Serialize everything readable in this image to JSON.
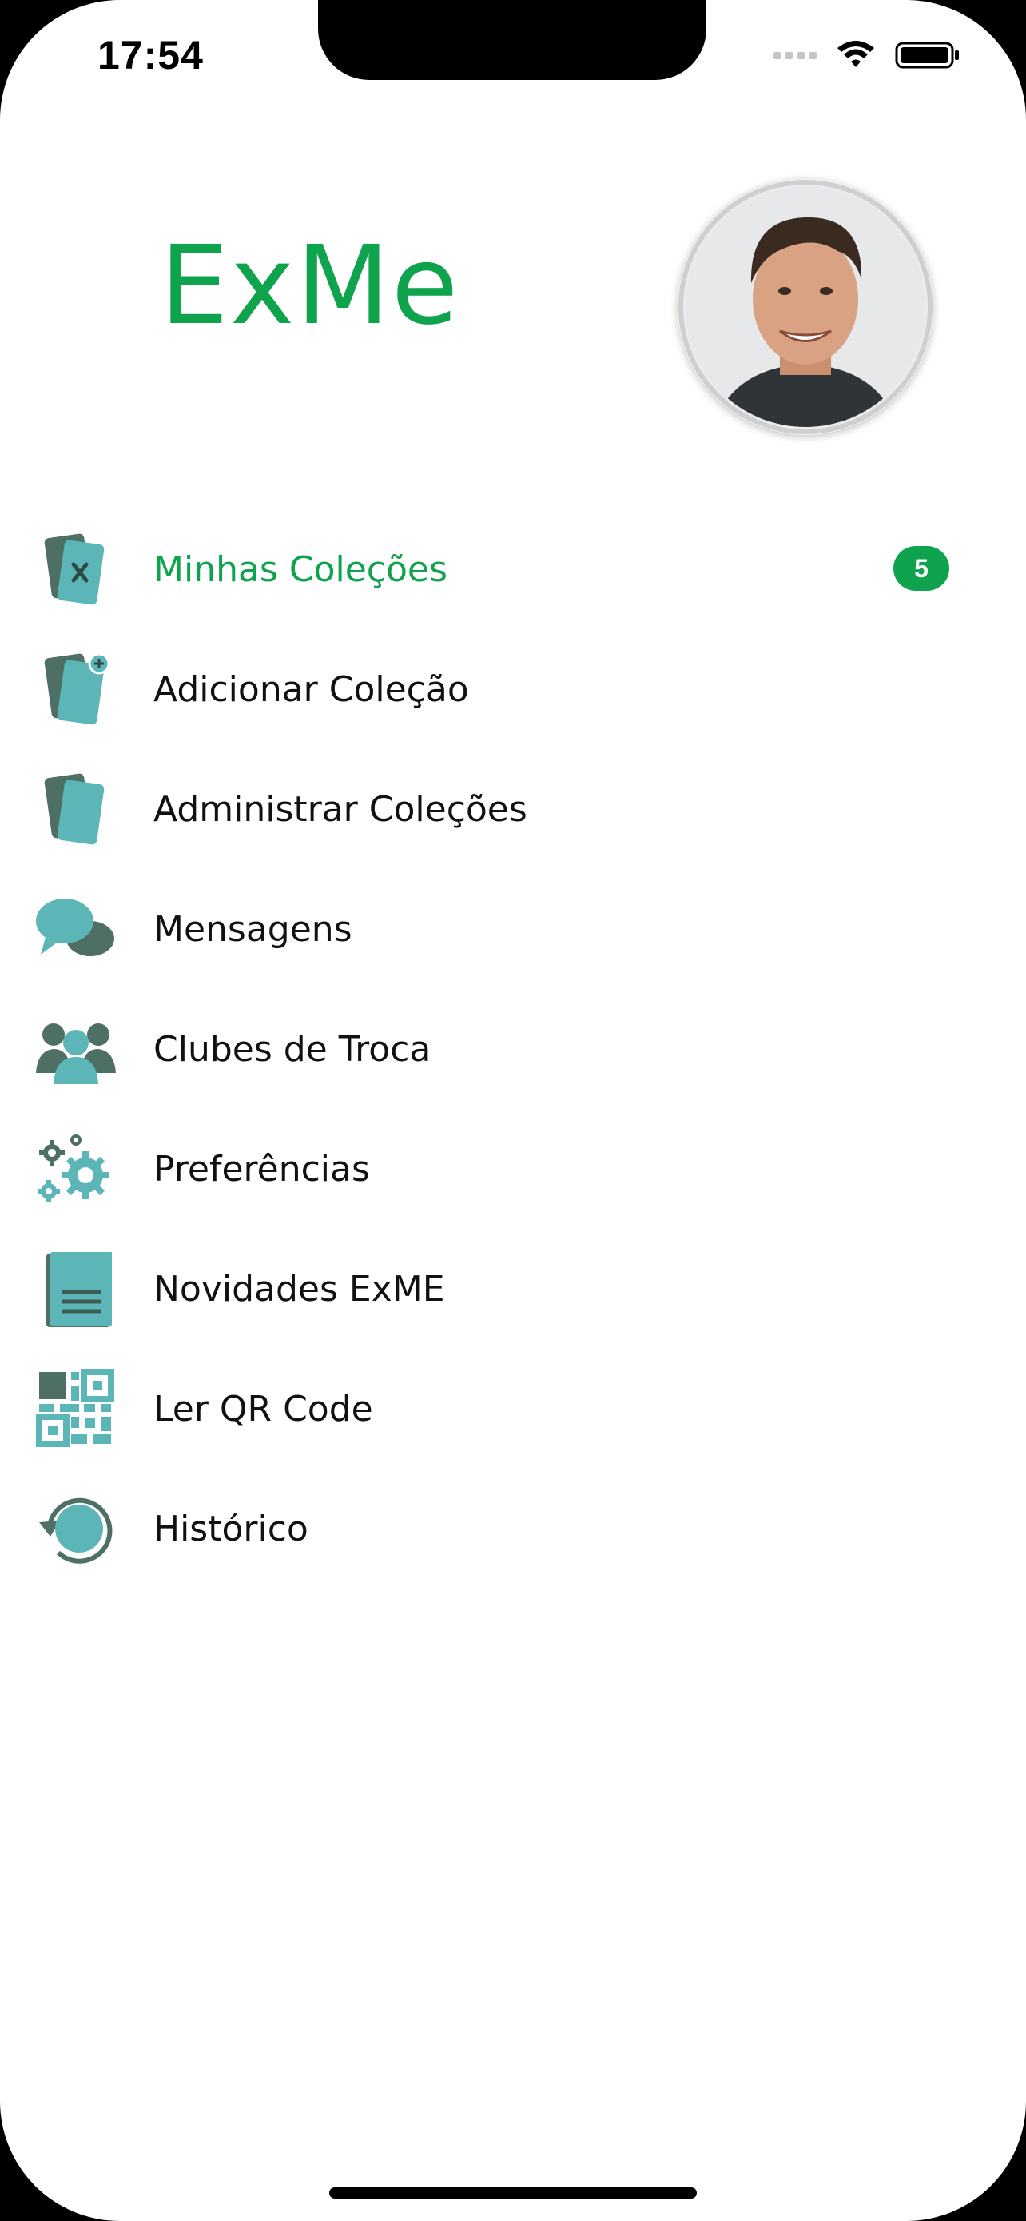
{
  "status_bar": {
    "time": "17:54"
  },
  "header": {
    "logo_text": "ExMe"
  },
  "colors": {
    "brand_green": "#0fa34d",
    "icon_teal": "#5cb6b8",
    "icon_dark": "#4e6f64"
  },
  "menu": {
    "items": [
      {
        "label": "Minhas Coleções",
        "icon": "cards-x-icon",
        "active": true,
        "badge": "5"
      },
      {
        "label": "Adicionar Coleção",
        "icon": "cards-add-icon"
      },
      {
        "label": "Administrar Coleções",
        "icon": "cards-icon"
      },
      {
        "label": "Mensagens",
        "icon": "chat-bubbles-icon"
      },
      {
        "label": "Clubes de Troca",
        "icon": "users-group-icon"
      },
      {
        "label": "Preferências",
        "icon": "gears-icon"
      },
      {
        "label": "Novidades ExME",
        "icon": "document-icon"
      },
      {
        "label": "Ler QR Code",
        "icon": "qr-code-icon"
      },
      {
        "label": "Histórico",
        "icon": "history-icon"
      }
    ]
  }
}
